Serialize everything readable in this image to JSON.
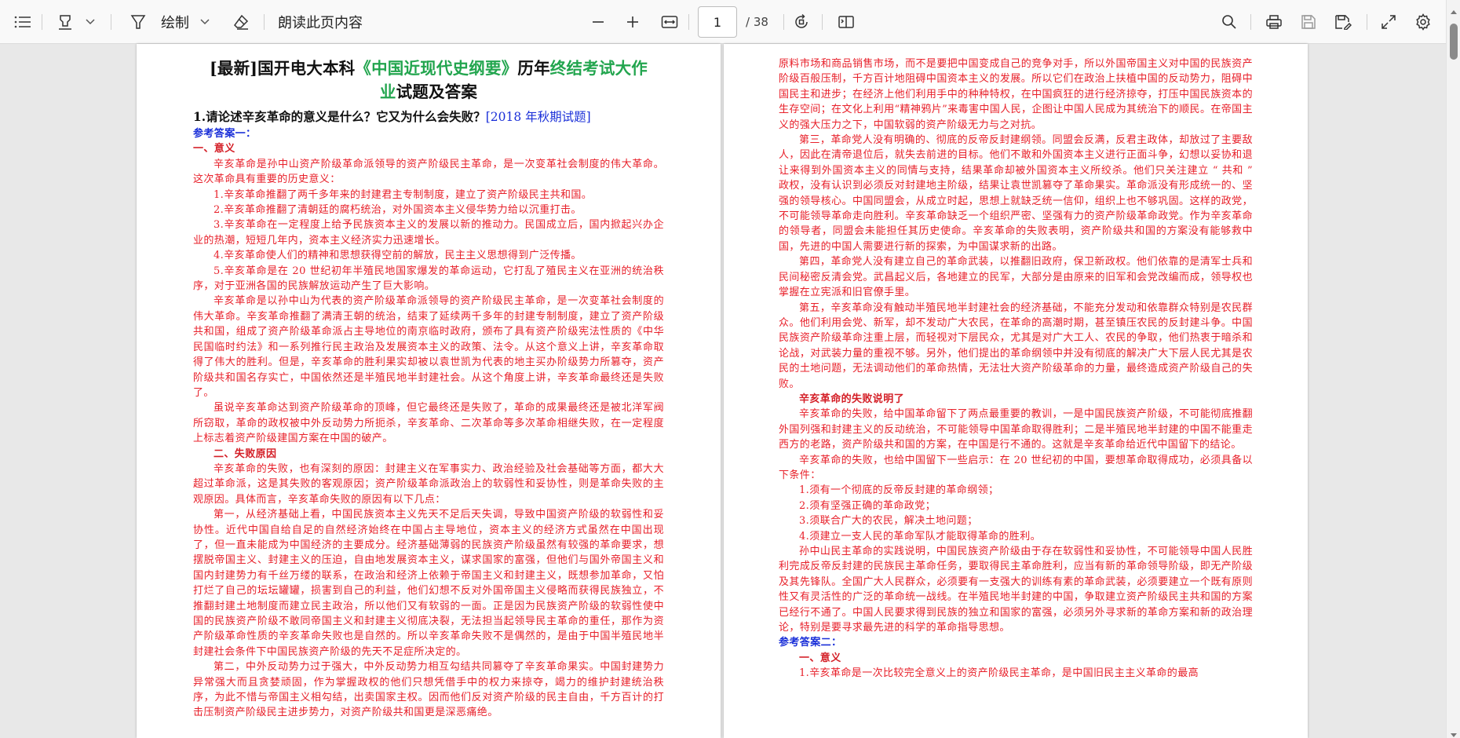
{
  "toolbar": {
    "draw_label": "绘制",
    "read_aloud_label": "朗读此页内容",
    "page_current": "1",
    "page_total": "/ 38",
    "icons": [
      "contents-icon",
      "highlight-icon",
      "draw-icon",
      "eraser-icon",
      "zoom-out-icon",
      "zoom-in-icon",
      "fit-width-icon",
      "rotate-icon",
      "page-view-icon",
      "search-icon",
      "print-icon",
      "save-icon",
      "save-as-icon",
      "fullscreen-icon",
      "settings-icon"
    ]
  },
  "left_page": {
    "title_part1": "[最新]国开电大本科",
    "title_green1": "《中国近现代史纲要》",
    "title_part2": "历年",
    "title_green2a": "终结考试大作",
    "title_green2b": "业",
    "title_part3": "试题及答案",
    "question": "1.请论述辛亥革命的意义是什么？它又为什么会失败？",
    "question_tag": "[2018 年秋期试题]",
    "ref_answer": "参考答案一：",
    "heading_1": "一、意义",
    "para_1": "辛亥革命是孙中山资产阶级革命派领导的资产阶级民主革命，是一次变革社会制度的伟大革命。这次革命具有重要的历史意义：",
    "item_1": "1.辛亥革命推翻了两千多年来的封建君主专制制度，建立了资产阶级民主共和国。",
    "item_2": "2.辛亥革命推翻了清朝廷的腐朽统治，对外国资本主义侵华势力给以沉重打击。",
    "item_3": "3.辛亥革命在一定程度上给予民族资本主义的发展以新的推动力。民国成立后，国内掀起兴办企业的热潮，短短几年内，资本主义经济实力迅速增长。",
    "item_4": "4.辛亥革命使人们的精神和思想获得空前的解放，民主主义思想得到广泛传播。",
    "item_5": "5.辛亥革命是在 20 世纪初年半殖民地国家爆发的革命运动，它打乱了殖民主义在亚洲的统治秩序，对于亚洲各国的民族解放运动产生了巨大影响。",
    "para_2": "辛亥革命是以孙中山为代表的资产阶级革命派领导的资产阶级民主革命，是一次变革社会制度的伟大革命。辛亥革命推翻了满清王朝的统治，结束了延续两千多年的封建专制制度，建立了资产阶级共和国，组成了资产阶级革命派占主导地位的南京临时政府，颁布了具有资产阶级宪法性质的《中华民国临时约法》和一系列推行民主政治及发展资本主义的政策、法令。从这个意义上讲，辛亥革命取得了伟大的胜利。但是，辛亥革命的胜利果实却被以袁世凯为代表的地主买办阶级势力所篡夺，资产阶级共和国名存实亡，中国依然还是半殖民地半封建社会。从这个角度上讲，辛亥革命最终还是失败了。",
    "para_3": "虽说辛亥革命达到资产阶级革命的顶峰，但它最终还是失败了，革命的成果最终还是被北洋军阀所窃取，革命的政权被中外反动势力所扼杀，辛亥革命、二次革命等多次革命相继失败，在一定程度上标志着资产阶级建国方案在中国的破产。",
    "heading_2": "二、失败原因",
    "para_4": "辛亥革命的失败，也有深刻的原因：封建主义在军事实力、政治经验及社会基础等方面，都大大超过革命派，这是其失败的客观原因；资产阶级革命派政治上的软弱性和妥协性，则是革命失败的主观原因。具体而言，辛亥革命失败的原因有以下几点：",
    "para_5": "第一，从经济基础上看，中国民族资本主义先天不足后天失调，导致中国资产阶级的软弱性和妥协性。近代中国自给自足的自然经济始终在中国占主导地位，资本主义的经济方式虽然在中国出现了，但一直未能成为中国经济的主要成分。经济基础薄弱的民族资产阶级虽然有较强的革命要求，想摆脱帝国主义、封建主义的压迫，自由地发展资本主义，谋求国家的富强，但他们与国外帝国主义和国内封建势力有千丝万缕的联系，在政治和经济上依赖于帝国主义和封建主义，既想参加革命，又怕打烂了自己的坛坛罐罐，损害到自己的利益，他们幻想不反对外国帝国主义侵略而获得民族独立，不推翻封建土地制度而建立民主政治，所以他们又有软弱的一面。正是因为民族资产阶级的软弱性使中国的民族资产阶级不敢同帝国主义和封建主义彻底决裂，无法担当起领导民主革命的重任，那作为资产阶级革命性质的辛亥革命失败也是自然的。所以辛亥革命失败不是偶然的，是由于中国半殖民地半封建社会条件下中国民族资产阶级的先天不足症所决定的。",
    "para_6": "第二，中外反动势力过于强大，中外反动势力相互勾结共同篡夺了辛亥革命果实。中国封建势力异常强大而且贪婪顽固，作为掌握政权的他们只想凭借手中的权力来掠夺，竭力的维护封建统治秩序，为此不惜与帝国主义相勾结，出卖国家主权。因而他们反对资产阶级的民主自由，千方百计的打击压制资产阶级民主进步势力，对资产阶级共和国更是深恶痛绝。"
  },
  "right_page": {
    "para_a": "原料市场和商品销售市场，而不是要把中国变成自己的竞争对手，所以外国帝国主义对中国的民族资产阶级百般压制，千方百计地阻碍中国资本主义的发展。所以它们在政治上扶植中国的反动势力，阻碍中国民主和进步；在经济上他们利用手中的种种特权，在中国疯狂的进行经济掠夺，打压中国民族资本的生存空间；在文化上利用“精神鸦片”来毒害中国人民，企图让中国人民成为其统治下的顺民。在帝国主义的强大压力之下，中国软弱的资产阶级无力与之对抗。",
    "para_b": "第三，革命党人没有明确的、彻底的反帝反封建纲领。同盟会反满，反君主政体，却放过了主要敌人，因此在清帝退位后，就失去前进的目标。他们不敢和外国资本主义进行正面斗争，幻想以妥协和退让来得到外国资本主义的同情与支持，结果革命却被外国资本主义所绞杀。他们只关注建立 “ 共和 ” 政权，没有认识到必须反对封建地主阶级，结果让袁世凯篡夺了革命果实。革命派没有形成统一的、坚强的领导核心。中国同盟会，从成立时起，思想上就缺乏统一信仰，组织上也不够巩固。这样的政党，不可能领导革命走向胜利。辛亥革命缺乏一个组织严密、坚强有力的资产阶级革命政党。作为辛亥革命的领导者，同盟会未能担任其历史使命。辛亥革命的失败表明，资产阶级共和国的方案没有能够救中国，先进的中国人需要进行新的探索，为中国谋求新的出路。",
    "para_c": "第四，革命党人没有建立自己的革命武装，以推翻旧政府，保卫新政权。他们依靠的是清军士兵和民间秘密反清会党。武昌起义后，各地建立的民军，大部分是由原来的旧军和会党改编而成，领导权也掌握在立宪派和旧官僚手里。",
    "para_d": "第五，辛亥革命没有触动半殖民地半封建社会的经济基础，不能充分发动和依靠群众特别是农民群众。他们利用会党、新军，却不发动广大农民，在革命的高潮时期，甚至镇压农民的反封建斗争。中国民族资产阶级革命注重上层，而轻视对下层民众，尤其是对广大工人、农民的争取，他们热衷于暗杀和论战，对武装力量的重视不够。另外，他们提出的革命纲领中并没有彻底的解决广大下层人民尤其是农民的土地问题，无法调动他们的革命热情，无法壮大资产阶级革命的力量，最终造成资产阶级自己的失败。",
    "heading_c": "辛亥革命的失败说明了",
    "para_e": "辛亥革命的失败，给中国革命留下了两点最重要的教训，一是中国民族资产阶级，不可能彻底推翻外国列强和封建主义的反动统治，不可能领导中国革命取得胜利；二是半殖民地半封建的中国不能重走西方的老路，资产阶级共和国的方案，在中国是行不通的。这就是辛亥革命给近代中国留下的结论。",
    "para_f": "辛亥革命的失败，也给中国留下一些启示：在 20 世纪初的中国，要想革命取得成功，必须具备以下条件：",
    "cond_1": "1.须有一个彻底的反帝反封建的革命纲领；",
    "cond_2": "2.须有坚强正确的革命政党；",
    "cond_3": "3.须联合广大的农民，解决土地问题；",
    "cond_4": "4.须建立一支人民的革命军队才能取得革命的胜利。",
    "para_g": "孙中山民主革命的实践说明，中国民族资产阶级由于存在软弱性和妥协性，不可能领导中国人民胜利完成反帝反封建的民族民主革命任务，要取得民主革命胜利，应当有新的革命领导阶级，即无产阶级及其先锋队。全国广大人民群众，必须要有一支强大的训练有素的革命武装，必须要建立一个既有原则性又有灵活性的广泛的革命统一战线。在半殖民地半封建的中国，争取建立资产阶级民主共和国的方案已经行不通了。中国人民要求得到民族的独立和国家的富强，必须另外寻求新的革命方案和新的政治理论，特别是要寻求最先进的科学的革命指导思想。",
    "ref_answer_2": "参考答案二：",
    "heading_d": "一、意义",
    "para_h": "1.辛亥革命是一次比较完全意义上的资产阶级民主革命，是中国旧民主主义革命的最高"
  }
}
